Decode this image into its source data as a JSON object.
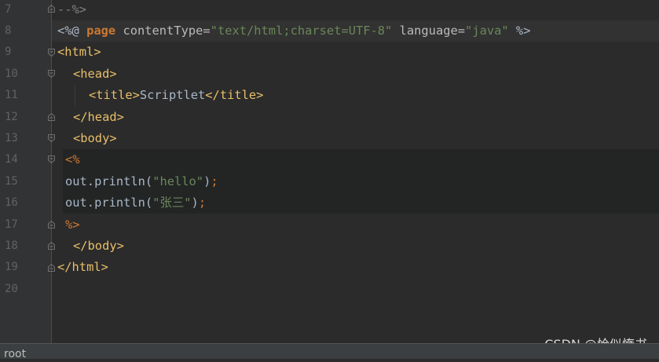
{
  "editor": {
    "line_numbers": [
      "7",
      "8",
      "9",
      "10",
      "11",
      "12",
      "13",
      "14",
      "15",
      "16",
      "17",
      "18",
      "19",
      "20"
    ],
    "code": {
      "l7_comment_end": "--%>",
      "l8_open": "<%@",
      "l8_page": "page",
      "l8_attr1": "contentType",
      "l8_eq1": "=",
      "l8_val1": "\"text/html;charset=UTF-8\"",
      "l8_attr2": "language",
      "l8_eq2": "=",
      "l8_val2": "\"java\"",
      "l8_close": "%>",
      "l9": "<html>",
      "l10": "<head>",
      "l11_open": "<title>",
      "l11_text": "Scriptlet",
      "l11_close": "</title>",
      "l12": "</head>",
      "l13": "<body>",
      "l14": "<%",
      "l15_ident": "out.println(",
      "l15_str": "\"hello\"",
      "l15_close": ")",
      "l15_semi": ";",
      "l16_ident": "out.println(",
      "l16_str": "\"张三\"",
      "l16_close": ")",
      "l16_semi": ";",
      "l17": "%>",
      "l18": "</body>",
      "l19": "</html>"
    }
  },
  "watermark": "CSDN @恰似惰书",
  "statusbar": {
    "text": "root"
  },
  "colors": {
    "background": "#2b2b2b",
    "gutter": "#313335",
    "tag": "#e8bf6a",
    "string": "#6a8759",
    "keyword": "#cc7832",
    "text": "#a9b7c6",
    "line_number": "#606366"
  }
}
